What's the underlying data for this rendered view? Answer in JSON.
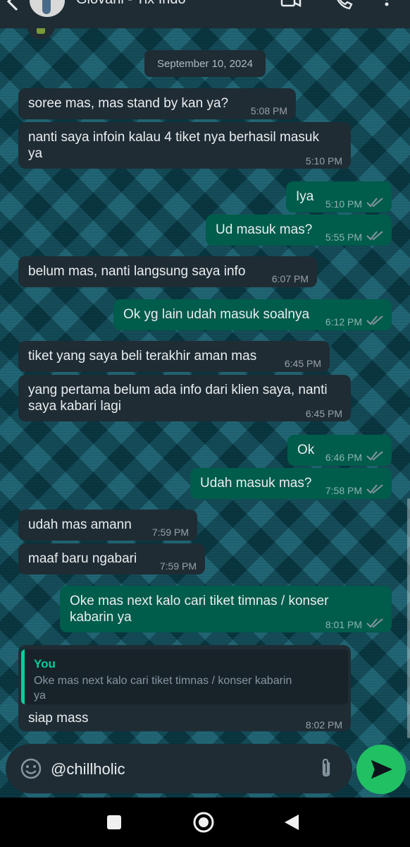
{
  "header": {
    "contact_name": "Giovani - Tix Indo"
  },
  "chat": {
    "date_divider": "September 10, 2024",
    "messages": [
      {
        "dir": "in",
        "text": "soree mas, mas stand by kan ya?",
        "time": "5:08 PM"
      },
      {
        "dir": "in",
        "lines": [
          "nanti saya infoin kalau 4 tiket nya berhasil masuk",
          "ya"
        ],
        "time": "5:10 PM"
      },
      {
        "dir": "out",
        "text": "Iya",
        "time": "5:10 PM",
        "status": "read"
      },
      {
        "dir": "out",
        "text": "Ud masuk mas?",
        "time": "5:55 PM",
        "status": "read"
      },
      {
        "dir": "in",
        "text": "belum mas, nanti langsung saya info",
        "time": "6:07 PM"
      },
      {
        "dir": "out",
        "text": "Ok yg lain udah masuk soalnya",
        "time": "6:12 PM",
        "status": "read"
      },
      {
        "dir": "in",
        "text": "tiket yang saya beli terakhir aman mas",
        "time": "6:45 PM"
      },
      {
        "dir": "in",
        "lines": [
          "yang pertama belum ada info dari klien saya, nanti",
          "saya kabari lagi"
        ],
        "time": "6:45 PM"
      },
      {
        "dir": "out",
        "text": "Ok",
        "time": "6:46 PM",
        "status": "read"
      },
      {
        "dir": "out",
        "text": "Udah masuk mas?",
        "time": "7:58 PM",
        "status": "read"
      },
      {
        "dir": "in",
        "text": "udah mas amann",
        "time": "7:59 PM"
      },
      {
        "dir": "in",
        "text": "maaf baru ngabari",
        "time": "7:59 PM"
      },
      {
        "dir": "out",
        "lines": [
          "Oke mas next kalo cari tiket timnas / konser",
          "kabarin ya"
        ],
        "time": "8:01 PM",
        "status": "read"
      },
      {
        "dir": "in",
        "reply_to": {
          "author": "You",
          "lines": [
            "Oke mas next kalo cari tiket timnas / konser kabarin",
            "ya"
          ]
        },
        "text": "siap mass",
        "time": "8:02 PM"
      }
    ]
  },
  "composer": {
    "value": "@chillholic"
  },
  "icons": {
    "back": "back-arrow-icon",
    "video": "video-call-icon",
    "call": "phone-call-icon",
    "menu": "more-vertical-icon",
    "emoji": "emoji-icon",
    "attach": "paperclip-icon",
    "send": "send-icon",
    "ticks": "double-check-icon",
    "nav_recents": "square-icon",
    "nav_home": "circle-icon",
    "nav_back": "triangle-back-icon"
  },
  "colors": {
    "incoming_bubble": "#1f2c34",
    "outgoing_bubble": "#005c4b",
    "send_button": "#21c063",
    "read_ticks": "#8696a0",
    "quote_author": "#06cf9c"
  }
}
